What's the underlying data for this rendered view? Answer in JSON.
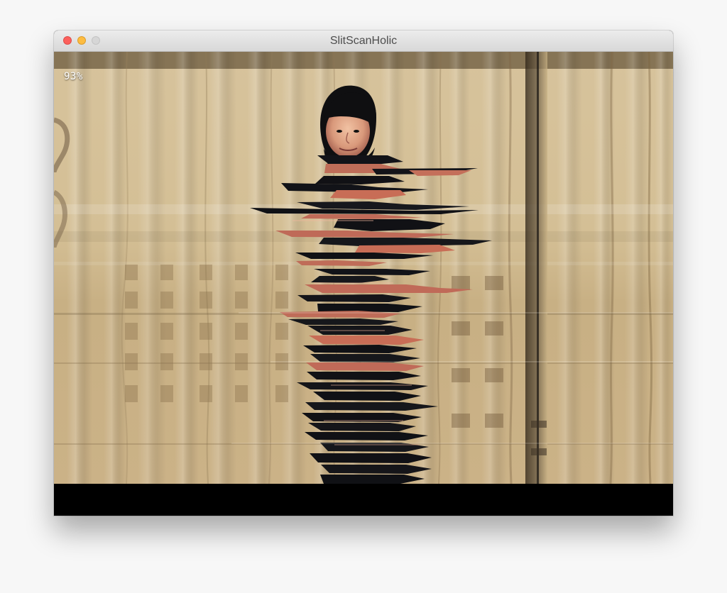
{
  "window": {
    "title": "SlitScanHolic",
    "controls": {
      "close": "close-button",
      "minimize": "minimize-button",
      "zoom": "zoom-button"
    }
  },
  "overlay": {
    "progress_text": "93%",
    "progress_value": 93
  },
  "colors": {
    "curtain_light": "#e8d6b0",
    "curtain_mid": "#ccb486",
    "curtain_dark": "#6e5734",
    "figure_dark": "#121318",
    "figure_skin": "#c46f5a",
    "bottom_bar": "#000000",
    "close": "#fc605c",
    "minimize": "#fdbc40",
    "zoom": "#d6d6d6"
  }
}
